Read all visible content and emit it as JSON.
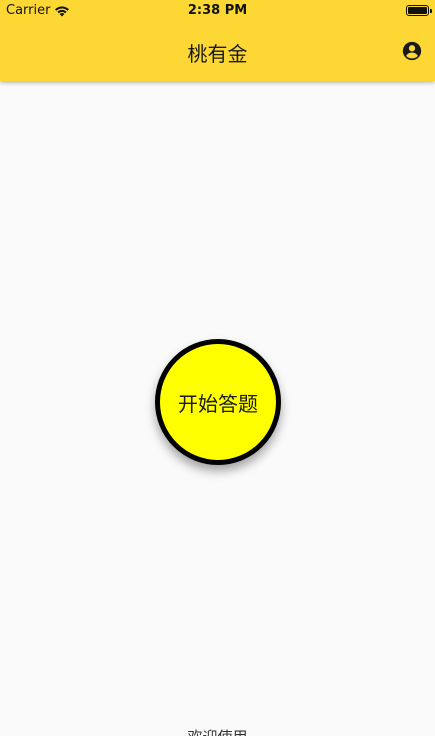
{
  "status_bar": {
    "carrier": "Carrier",
    "time": "2:38 PM"
  },
  "header": {
    "title": "桃有金",
    "background_color": "#fdd835",
    "action_icon": "account-circle-icon"
  },
  "main": {
    "start_button_label": "开始答题",
    "start_button_color": "#ffff00"
  },
  "footer": {
    "text": "欢迎使用"
  }
}
